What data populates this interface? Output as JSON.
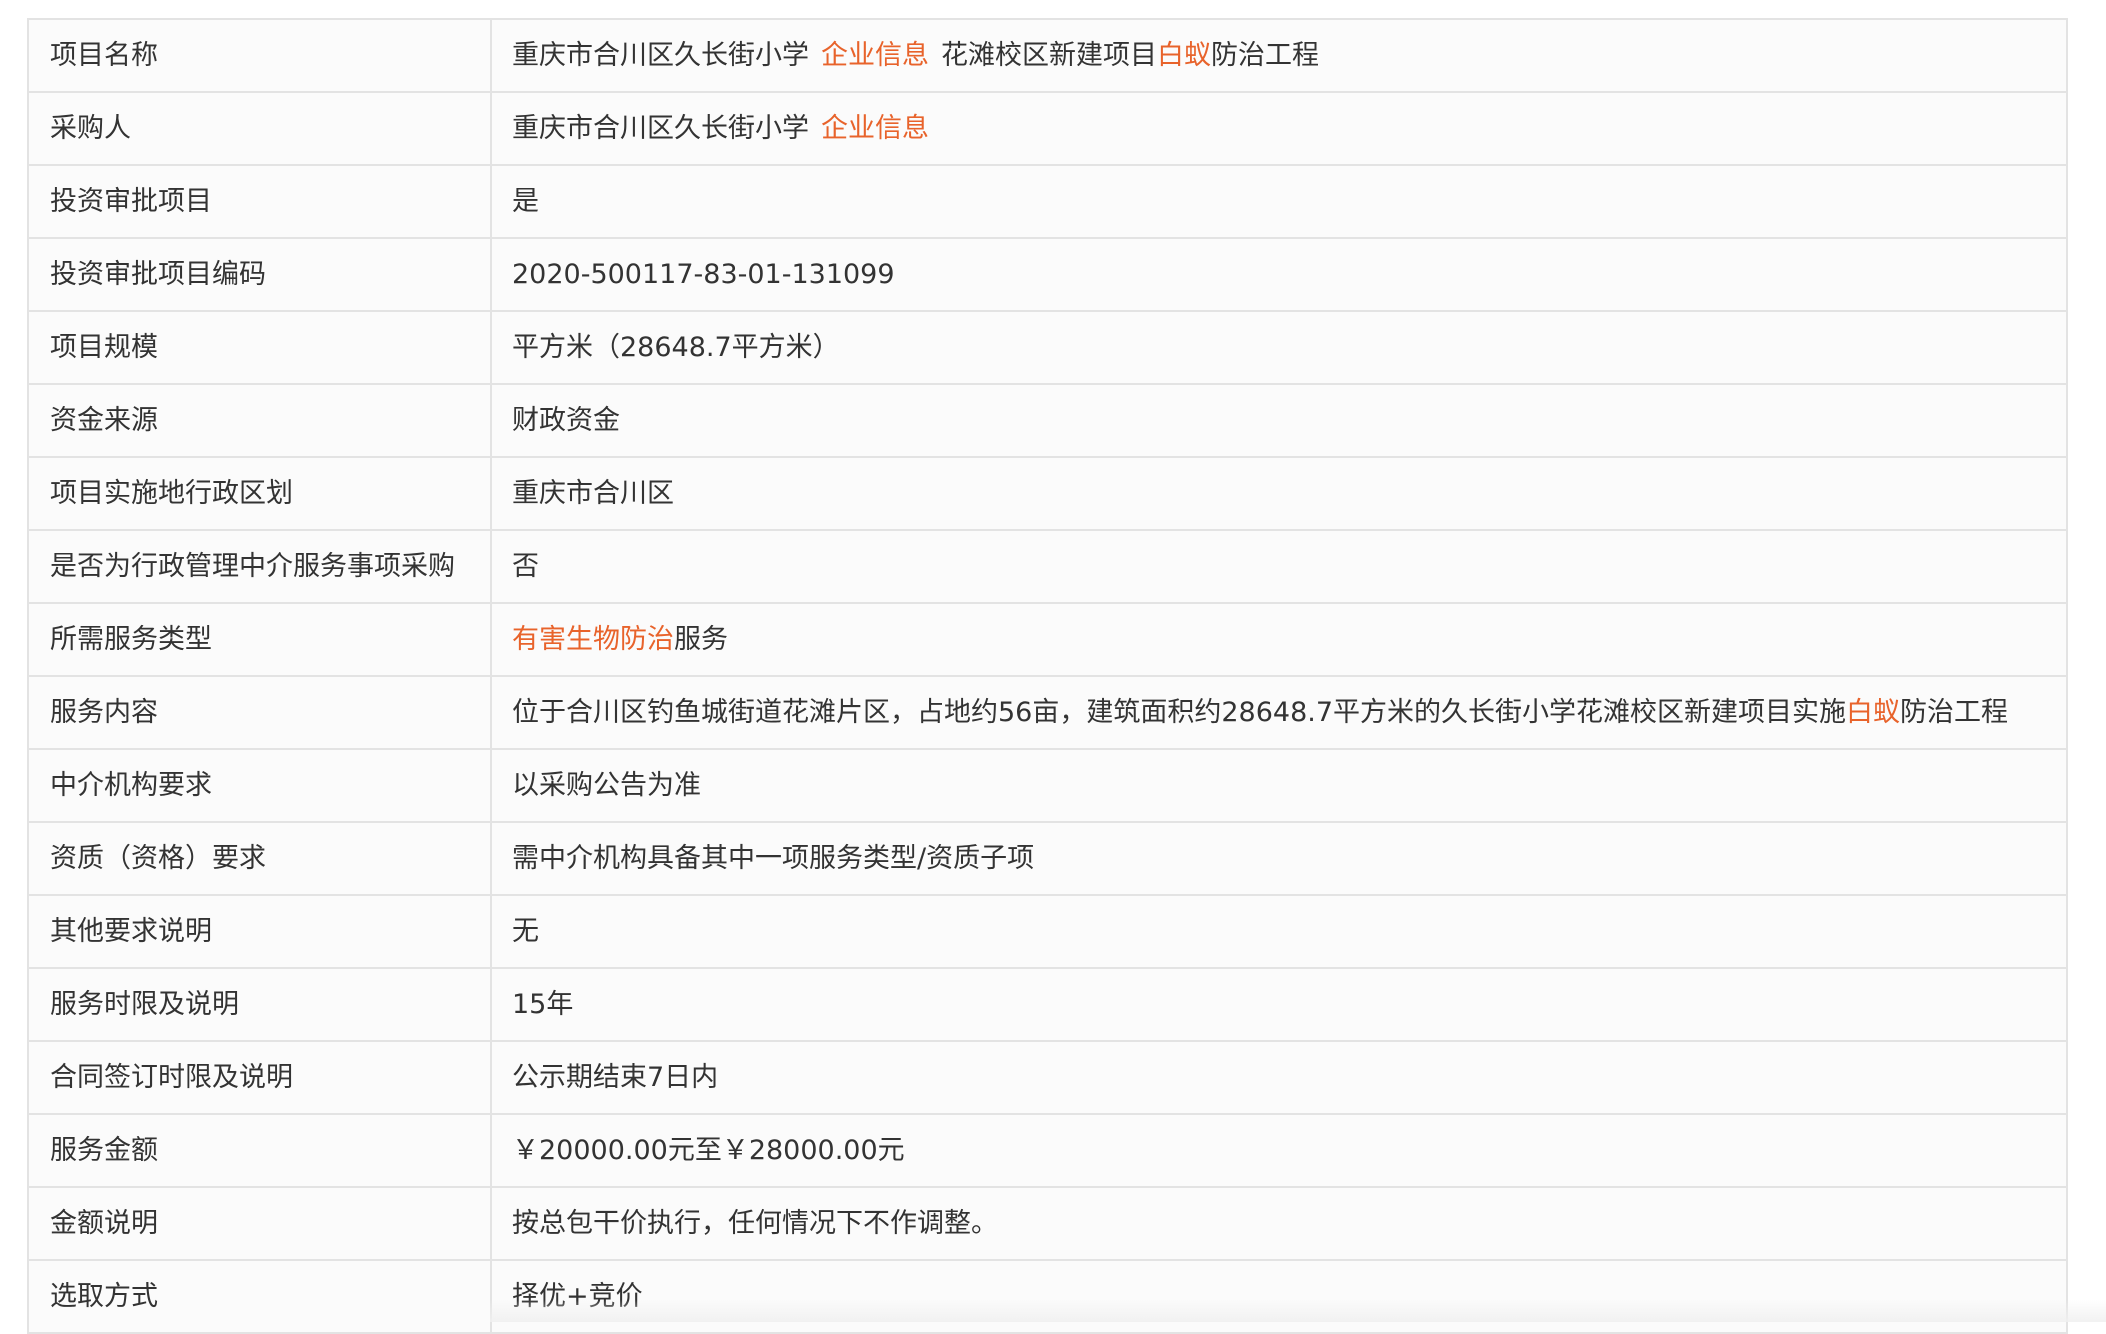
{
  "rows": [
    {
      "label": "项目名称",
      "value_a": "重庆市合川区久长街小学",
      "link": "企业信息",
      "value_b": "花滩校区新建项目",
      "hl": "白蚁",
      "value_c": "防治工程"
    },
    {
      "label": "采购人",
      "value_a": "重庆市合川区久长街小学",
      "link": "企业信息"
    },
    {
      "label": "投资审批项目",
      "value": "是"
    },
    {
      "label": "投资审批项目编码",
      "value": "2020-500117-83-01-131099"
    },
    {
      "label": "项目规模",
      "value": "平方米（28648.7平方米）"
    },
    {
      "label": "资金来源",
      "value": "财政资金"
    },
    {
      "label": "项目实施地行政区划",
      "value": "重庆市合川区"
    },
    {
      "label": "是否为行政管理中介服务事项采购",
      "value": "否"
    },
    {
      "label": "所需服务类型",
      "hl": "有害生物防治",
      "value": "服务"
    },
    {
      "label": "服务内容",
      "value_a": "位于合川区钓鱼城街道花滩片区，占地约56亩，建筑面积约28648.7平方米的久长街小学花滩校区新建项目实施",
      "hl": "白蚁",
      "value_b": "防治工程"
    },
    {
      "label": "中介机构要求",
      "value": "以采购公告为准"
    },
    {
      "label": "资质（资格）要求",
      "value": "需中介机构具备其中一项服务类型/资质子项"
    },
    {
      "label": "其他要求说明",
      "value": "无"
    },
    {
      "label": "服务时限及说明",
      "value": "15年"
    },
    {
      "label": "合同签订时限及说明",
      "value": "公示期结束7日内"
    },
    {
      "label": "服务金额",
      "value": "￥20000.00元至￥28000.00元"
    },
    {
      "label": "金额说明",
      "value": "按总包干价执行，任何情况下不作调整。"
    },
    {
      "label": "选取方式",
      "value": "择优+竞价"
    }
  ],
  "colors": {
    "accent": "#e8632b",
    "border": "#e3e3e3",
    "text": "#333333",
    "row_bg": "#fbfbfb"
  }
}
